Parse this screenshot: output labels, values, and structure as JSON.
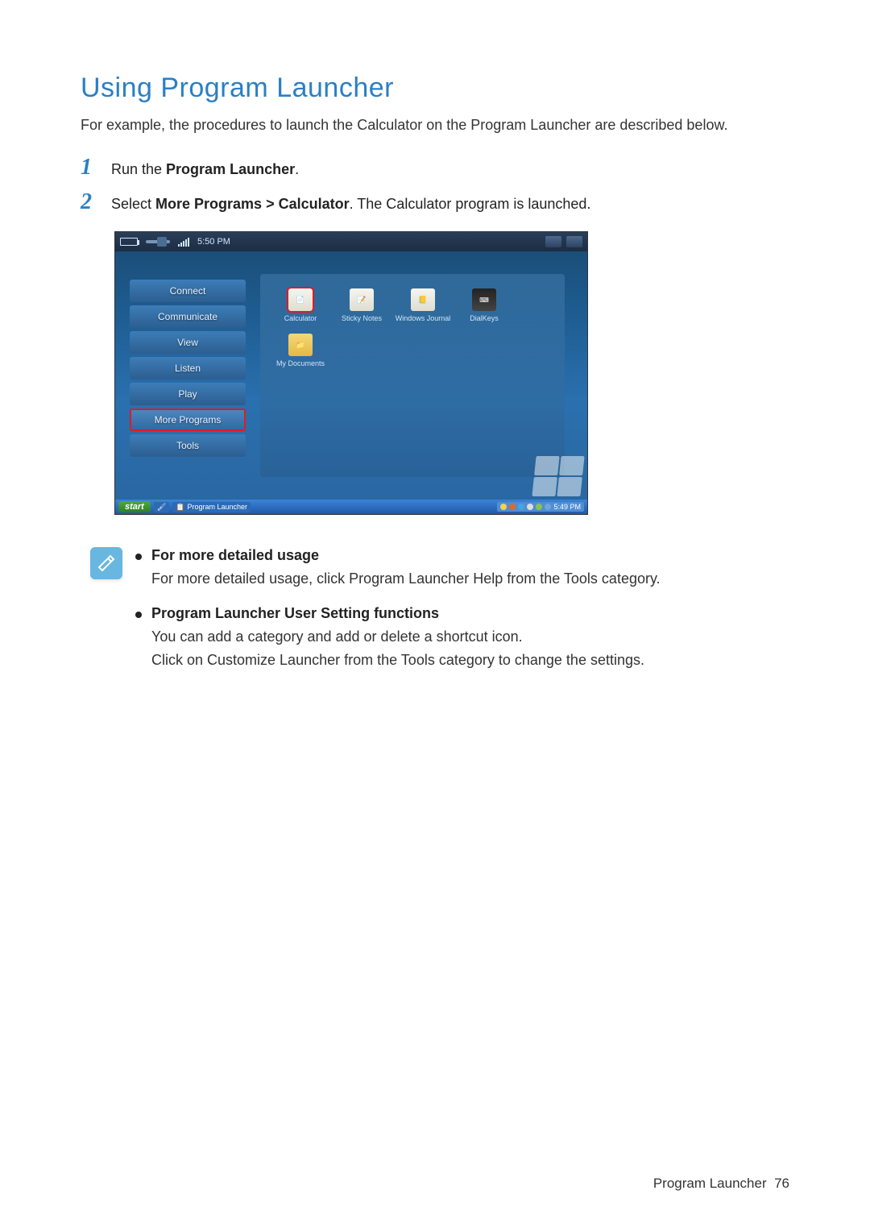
{
  "title": "Using Program Launcher",
  "intro": "For example, the procedures to launch the Calculator on the Program Launcher are described below.",
  "steps": [
    {
      "num": "1",
      "parts": [
        "Run the ",
        "Program Launcher",
        "."
      ]
    },
    {
      "num": "2",
      "parts": [
        "Select ",
        "More Programs > Calculator",
        ". The Calculator program is launched."
      ]
    }
  ],
  "screenshot": {
    "clock": "5:50 PM",
    "sidebar": [
      "Connect",
      "Communicate",
      "View",
      "Listen",
      "Play",
      "More Programs",
      "Tools"
    ],
    "sidebar_highlight_index": 5,
    "apps": [
      {
        "label": "Calculator",
        "highlight": true,
        "type": "doc"
      },
      {
        "label": "Sticky Notes",
        "highlight": false,
        "type": "doc"
      },
      {
        "label": "Windows Journal",
        "highlight": false,
        "type": "doc"
      },
      {
        "label": "DialKeys",
        "highlight": false,
        "type": "kb"
      },
      {
        "label": "My Documents",
        "highlight": false,
        "type": "folder"
      }
    ],
    "taskbar": {
      "start": "start",
      "app": "Program Launcher",
      "tray_time": "5:49 PM"
    }
  },
  "notes": [
    {
      "heading": "For more detailed usage",
      "body": "For more detailed usage, click Program Launcher Help from the Tools category."
    },
    {
      "heading": "Program Launcher User Setting functions",
      "body": "You can add a category and add or delete a shortcut icon.\nClick on Customize Launcher from the Tools category to change the settings."
    }
  ],
  "footer": {
    "section": "Program Launcher",
    "page": "76"
  }
}
